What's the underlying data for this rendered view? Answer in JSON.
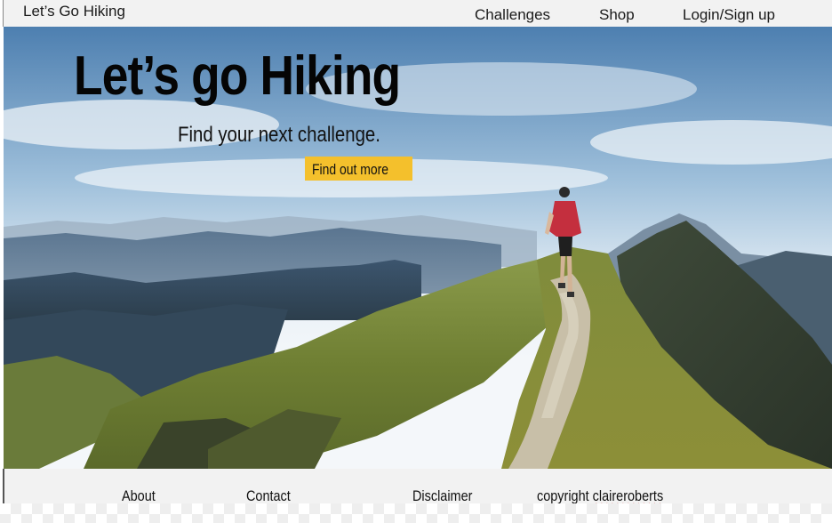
{
  "nav": {
    "brand": "Let’s Go Hiking",
    "links": [
      "Challenges",
      "Shop",
      "Login/Sign up"
    ]
  },
  "hero": {
    "title": "Let’s go Hiking",
    "subtitle": "Find your next challenge.",
    "cta_label": "Find out more",
    "cta_color": "#f4c02c"
  },
  "footer": {
    "about": "About",
    "contact": "Contact",
    "disclaimer": "Disclaimer",
    "copyright_prefix": "copyright",
    "copyright_name": "claireroberts"
  }
}
